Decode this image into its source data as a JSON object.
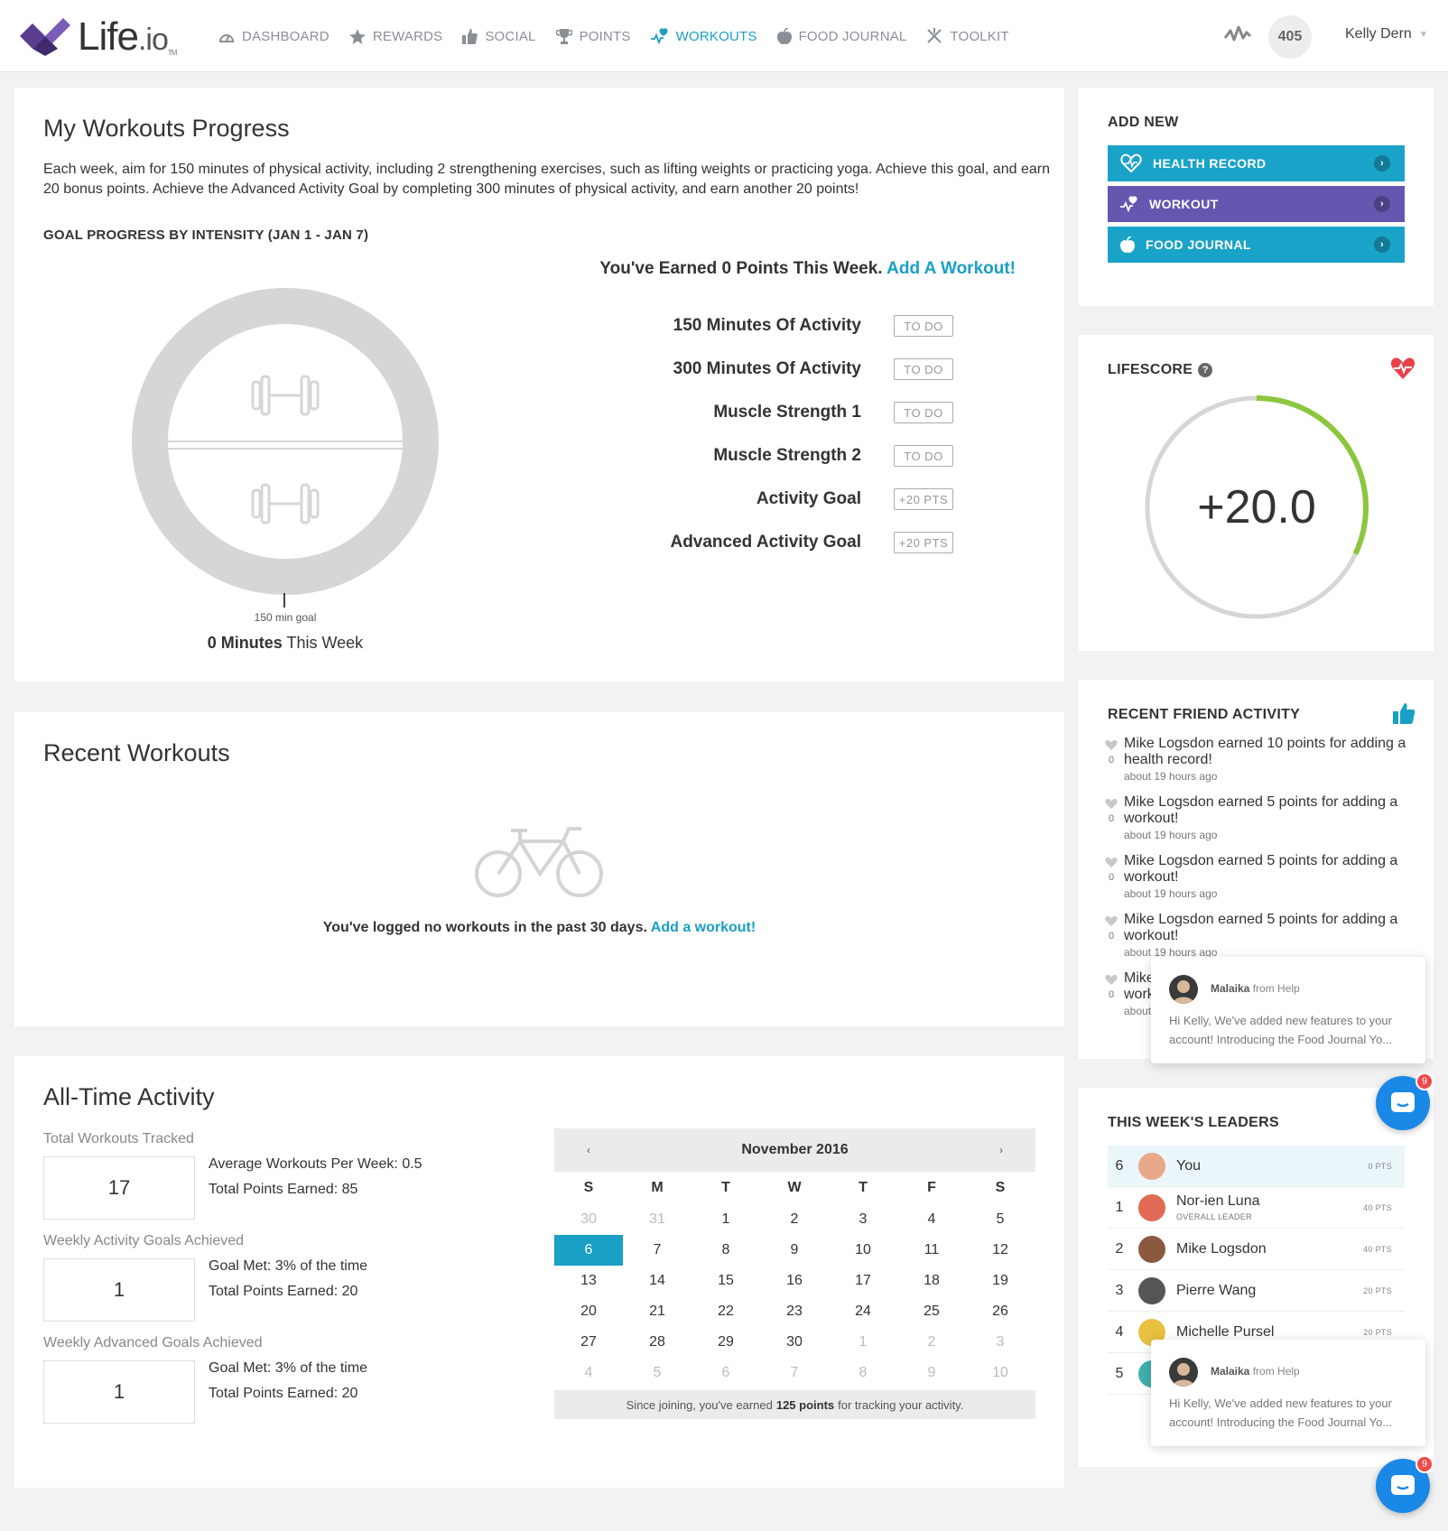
{
  "nav": {
    "logo": {
      "main": "Life",
      "dot": ".",
      "io": "io",
      "tm": "TM"
    },
    "items": [
      {
        "label": "DASHBOARD",
        "icon": "dashboard-gauge-icon",
        "active": false
      },
      {
        "label": "REWARDS",
        "icon": "star-icon",
        "active": false
      },
      {
        "label": "SOCIAL",
        "icon": "thumbs-up-icon",
        "active": false
      },
      {
        "label": "POINTS",
        "icon": "trophy-icon",
        "active": false
      },
      {
        "label": "WORKOUTS",
        "icon": "heartbeat-icon",
        "active": true
      },
      {
        "label": "FOOD JOURNAL",
        "icon": "apple-icon",
        "active": false
      },
      {
        "label": "TOOLKIT",
        "icon": "tools-icon",
        "active": false
      }
    ],
    "points": "405",
    "user": "Kelly Dern"
  },
  "progress": {
    "title": "My Workouts Progress",
    "intro": "Each week, aim for 150 minutes of physical activity, including 2 strengthening exercises, such as lifting weights or practicing yoga. Achieve this goal, and earn 20 bonus points. Achieve the Advanced Activity Goal by completing 300 minutes of physical activity, and earn another 20 points!",
    "subheading": "GOAL PROGRESS BY INTENSITY (JAN 1 - JAN 7)",
    "goal_label": "150 min goal",
    "minutes_value": "0 Minutes",
    "minutes_suffix": " This Week",
    "earned_text": "You've Earned 0 Points This Week. ",
    "earned_link": "Add A Workout!",
    "goals": [
      {
        "name": "150 Minutes Of Activity",
        "badge": "TO DO"
      },
      {
        "name": "300 Minutes Of Activity",
        "badge": "TO DO"
      },
      {
        "name": "Muscle Strength 1",
        "badge": "TO DO"
      },
      {
        "name": "Muscle Strength 2",
        "badge": "TO DO"
      },
      {
        "name": "Activity Goal",
        "badge": "+20 PTS"
      },
      {
        "name": "Advanced Activity Goal",
        "badge": "+20 PTS"
      }
    ]
  },
  "recent": {
    "title": "Recent Workouts",
    "empty_text": "You've logged no workouts in the past 30 days. ",
    "empty_link": "Add a workout!"
  },
  "alltime": {
    "title": "All-Time Activity",
    "stats": [
      {
        "label": "Total Workouts Tracked",
        "value": "17",
        "line1": "Average Workouts Per Week: 0.5",
        "line2": "Total Points Earned: 85"
      },
      {
        "label": "Weekly Activity Goals Achieved",
        "value": "1",
        "line1": "Goal Met: 3% of the time",
        "line2": "Total Points Earned: 20"
      },
      {
        "label": "Weekly Advanced Goals Achieved",
        "value": "1",
        "line1": "Goal Met: 3% of the time",
        "line2": "Total Points Earned: 20"
      }
    ],
    "calendar": {
      "month": "November 2016",
      "prev": "‹",
      "next": "›",
      "weekdays": [
        "S",
        "M",
        "T",
        "W",
        "T",
        "F",
        "S"
      ],
      "days": [
        {
          "d": "30",
          "muted": true
        },
        {
          "d": "31",
          "muted": true
        },
        {
          "d": "1"
        },
        {
          "d": "2"
        },
        {
          "d": "3"
        },
        {
          "d": "4"
        },
        {
          "d": "5"
        },
        {
          "d": "6",
          "today": true
        },
        {
          "d": "7"
        },
        {
          "d": "8"
        },
        {
          "d": "9"
        },
        {
          "d": "10"
        },
        {
          "d": "11"
        },
        {
          "d": "12"
        },
        {
          "d": "13"
        },
        {
          "d": "14"
        },
        {
          "d": "15"
        },
        {
          "d": "16"
        },
        {
          "d": "17"
        },
        {
          "d": "18"
        },
        {
          "d": "19"
        },
        {
          "d": "20"
        },
        {
          "d": "21"
        },
        {
          "d": "22"
        },
        {
          "d": "23"
        },
        {
          "d": "24"
        },
        {
          "d": "25"
        },
        {
          "d": "26"
        },
        {
          "d": "27"
        },
        {
          "d": "28"
        },
        {
          "d": "29"
        },
        {
          "d": "30"
        },
        {
          "d": "1",
          "muted": true
        },
        {
          "d": "2",
          "muted": true
        },
        {
          "d": "3",
          "muted": true
        },
        {
          "d": "4",
          "muted": true
        },
        {
          "d": "5",
          "muted": true
        },
        {
          "d": "6",
          "muted": true
        },
        {
          "d": "7",
          "muted": true
        },
        {
          "d": "8",
          "muted": true
        },
        {
          "d": "9",
          "muted": true
        },
        {
          "d": "10",
          "muted": true
        }
      ],
      "footer_pre": "Since joining, you've earned",
      "footer_bold": "125 points",
      "footer_post": "for tracking your activity."
    }
  },
  "add_new": {
    "heading": "ADD NEW",
    "buttons": [
      {
        "label": "HEALTH RECORD",
        "icon": "heart-outline-icon",
        "color": "#1aa3c8"
      },
      {
        "label": "WORKOUT",
        "icon": "heartbeat-icon",
        "color": "#6557b0"
      },
      {
        "label": "FOOD JOURNAL",
        "icon": "apple-icon",
        "color": "#1aa3c8"
      }
    ]
  },
  "lifescore": {
    "heading": "LIFESCORE",
    "help": "?",
    "value": "+20.0",
    "progress_fraction": 0.32,
    "ring_color": "#8cc63f"
  },
  "friends": {
    "heading": "RECENT FRIEND ACTIVITY",
    "items": [
      {
        "text": "Mike Logsdon earned 10 points for adding a health record!",
        "time": "about 19 hours ago",
        "likes": "0"
      },
      {
        "text": "Mike Logsdon earned 5 points for adding a workout!",
        "time": "about 19 hours ago",
        "likes": "0"
      },
      {
        "text": "Mike Logsdon earned 5 points for adding a workout!",
        "time": "about 19 hours ago",
        "likes": "0"
      },
      {
        "text": "Mike Logsdon earned 5 points for adding a workout!",
        "time": "about 19 hours ago",
        "likes": "0"
      },
      {
        "text": "Mike Logsdon earned 5 points for adding a workout!",
        "time": "about 19 hours ago",
        "likes": "0"
      }
    ]
  },
  "leaders": {
    "heading": "THIS WEEK'S LEADERS",
    "rows": [
      {
        "rank": "6",
        "name": "You",
        "sub": "",
        "pts": "0 PTS",
        "me": true,
        "avatar": "#e8a88a"
      },
      {
        "rank": "1",
        "name": "Nor-ien Luna",
        "sub": "OVERALL LEADER",
        "pts": "40 PTS",
        "me": false,
        "avatar": "#e06a55"
      },
      {
        "rank": "2",
        "name": "Mike Logsdon",
        "sub": "",
        "pts": "40 PTS",
        "me": false,
        "avatar": "#8a5a40"
      },
      {
        "rank": "3",
        "name": "Pierre Wang",
        "sub": "",
        "pts": "20 PTS",
        "me": false,
        "avatar": "#555555"
      },
      {
        "rank": "4",
        "name": "Michelle Pursel",
        "sub": "",
        "pts": "20 PTS",
        "me": false,
        "avatar": "#e8c040"
      },
      {
        "rank": "5",
        "name": "",
        "sub": "",
        "pts": "",
        "me": false,
        "avatar": "#40b0b0"
      }
    ]
  },
  "chat": {
    "from_name": "Malaika",
    "from_suffix": "from Help",
    "message": "Hi Kelly, We've added new features to your account! Introducing the Food Journal Yo...",
    "count": "9"
  },
  "colors": {
    "accent": "#1a9fc5",
    "purple": "#6557b0",
    "green": "#8cc63f",
    "heart": "#e8414a"
  }
}
